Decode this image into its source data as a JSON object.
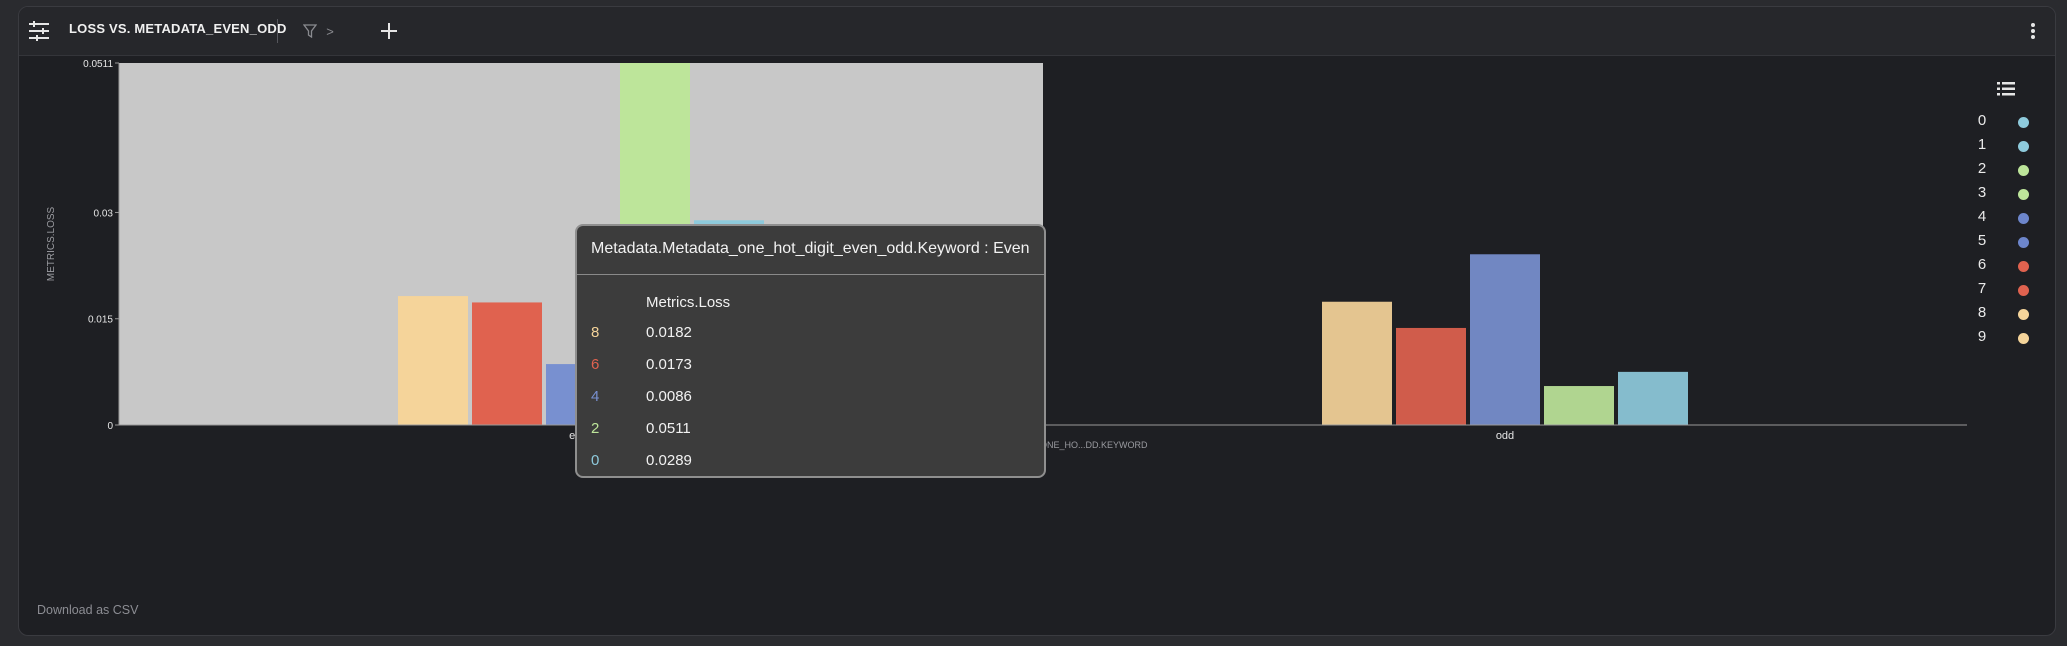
{
  "header": {
    "title": "LOSS VS. METADATA_EVEN_ODD",
    "filter_chevron": ">"
  },
  "footer": {
    "download_label": "Download as CSV"
  },
  "chart_data": {
    "type": "bar",
    "xlabel": "METADATA.METADATA_ONE_HO...DD.KEYWORD",
    "ylabel": "METRICS.LOSS",
    "ylim": [
      0,
      0.0511
    ],
    "yticks": [
      {
        "value": 0,
        "label": "0"
      },
      {
        "value": 0.015,
        "label": "0.015"
      },
      {
        "value": 0.03,
        "label": "0.03"
      },
      {
        "value": 0.0511,
        "label": "0.0511"
      }
    ],
    "categories": [
      "even",
      "odd"
    ],
    "highlighted_category": "even",
    "series": [
      {
        "name": "8",
        "color": "#f5d49a",
        "values": [
          0.0182,
          0.0174
        ]
      },
      {
        "name": "6",
        "color": "#e0624f",
        "values": [
          0.0173,
          0.0137
        ]
      },
      {
        "name": "4",
        "color": "#7890d0",
        "values": [
          0.0086,
          0.0241
        ]
      },
      {
        "name": "2",
        "color": "#bde59a",
        "values": [
          0.0511,
          0.0055
        ]
      },
      {
        "name": "0",
        "color": "#8ecadc",
        "values": [
          0.0289,
          0.0075
        ]
      }
    ],
    "legend": {
      "position": "right",
      "items": [
        {
          "label": "0",
          "color": "#8ecadc"
        },
        {
          "label": "1",
          "color": "#8ecadc"
        },
        {
          "label": "2",
          "color": "#bde59a"
        },
        {
          "label": "3",
          "color": "#bde59a"
        },
        {
          "label": "4",
          "color": "#6d86cc"
        },
        {
          "label": "5",
          "color": "#6d86cc"
        },
        {
          "label": "6",
          "color": "#e0624f"
        },
        {
          "label": "7",
          "color": "#e0624f"
        },
        {
          "label": "8",
          "color": "#f5d49a"
        },
        {
          "label": "9",
          "color": "#f5d49a"
        }
      ]
    },
    "tooltip": {
      "title": "Metadata.Metadata_one_hot_digit_even_odd.Keyword : Even",
      "column_header": "Metrics.Loss",
      "rows": [
        {
          "key": "8",
          "value": "0.0182",
          "color": "#f5d49a"
        },
        {
          "key": "6",
          "value": "0.0173",
          "color": "#e0624f"
        },
        {
          "key": "4",
          "value": "0.0086",
          "color": "#7890d0"
        },
        {
          "key": "2",
          "value": "0.0511",
          "color": "#bde59a"
        },
        {
          "key": "0",
          "value": "0.0289",
          "color": "#8ecadc"
        }
      ]
    }
  }
}
